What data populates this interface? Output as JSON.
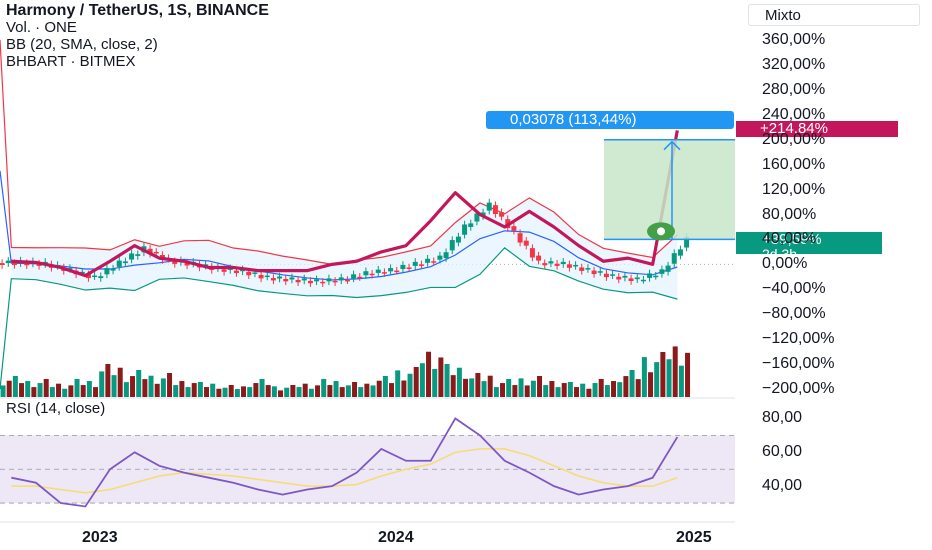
{
  "header": {
    "symbol_title": "Harmony / TetherUS, 1S, BINANCE",
    "volume_label": "Vol. · ONE",
    "bb_label": "BB (20, SMA, close, 2)",
    "compare_label": "BHBART · BITMEX",
    "rsi_label": "RSI (14, close)"
  },
  "toolbar": {
    "scale_mode": "Mixto"
  },
  "price_axis": {
    "labels": [
      "360,00%",
      "320,00%",
      "280,00%",
      "240,00%",
      "200,00%",
      "160,00%",
      "120,00%",
      "80,00%",
      "40,00%",
      "0,00%",
      "−40,00%",
      "−80,00%",
      "−120,00%",
      "−160,00%",
      "−200,00%"
    ],
    "top_value": 360,
    "bottom_value": -200
  },
  "rsi_axis": {
    "labels": [
      "80,00",
      "60,00",
      "40,00"
    ],
    "upper_band": 70,
    "lower_band": 30
  },
  "time_axis": {
    "labels": [
      "2023",
      "2024",
      "2025"
    ]
  },
  "tags": {
    "red_value": "+214,84%",
    "green_value": "+39,59%",
    "green_countdown": "2d 3h",
    "measure_text": "0,03078 (113,44%)"
  },
  "colors": {
    "up": "#089981",
    "down": "#f23645",
    "compare_line": "#c2185b",
    "bb_basis": "#2962ff",
    "bb_upper": "#f23645",
    "bb_lower": "#089981",
    "bb_fill": "#e3f2fd",
    "rsi_line": "#7e57c2",
    "rsi_ma": "#f7dc6f",
    "rsi_band": "#ede7f6",
    "measure": "#2196f3",
    "target_box": "#c8e6c9"
  },
  "chart_data": [
    {
      "type": "line",
      "title": "Harmony / TetherUS, 1S, BINANCE",
      "ylabel": "%",
      "ylim": [
        -200,
        370
      ],
      "x_ticks": [
        "2023",
        "2024",
        "2025"
      ],
      "series": [
        {
          "name": "Harmony / TetherUS",
          "x": [
            "2022-09",
            "2022-10",
            "2022-11",
            "2022-12",
            "2023-01",
            "2023-02",
            "2023-03",
            "2023-04",
            "2023-05",
            "2023-06",
            "2023-07",
            "2023-08",
            "2023-09",
            "2023-10",
            "2023-11",
            "2023-12",
            "2024-01",
            "2024-02",
            "2024-03",
            "2024-04",
            "2024-05",
            "2024-06",
            "2024-07",
            "2024-08",
            "2024-09",
            "2024-10",
            "2024-11",
            "2024-12"
          ],
          "values": [
            2,
            0,
            -10,
            -22,
            2,
            25,
            5,
            0,
            -8,
            -12,
            -22,
            -25,
            -28,
            -25,
            -15,
            -10,
            0,
            10,
            60,
            95,
            50,
            2,
            0,
            -10,
            -20,
            -25,
            -12,
            40
          ]
        },
        {
          "name": "BHBART · BITMEX",
          "x": [
            "2022-09",
            "2022-10",
            "2022-11",
            "2022-12",
            "2023-01",
            "2023-02",
            "2023-03",
            "2023-04",
            "2023-05",
            "2023-06",
            "2023-07",
            "2023-08",
            "2023-09",
            "2023-10",
            "2023-11",
            "2023-12",
            "2024-01",
            "2024-02",
            "2024-03",
            "2024-04",
            "2024-05",
            "2024-06",
            "2024-07",
            "2024-08",
            "2024-09",
            "2024-10",
            "2024-11",
            "2024-12"
          ],
          "values": [
            5,
            3,
            -5,
            -18,
            5,
            30,
            10,
            5,
            -5,
            -5,
            -10,
            -10,
            -10,
            0,
            5,
            20,
            30,
            70,
            115,
            80,
            60,
            85,
            60,
            30,
            5,
            10,
            0,
            215
          ]
        }
      ]
    },
    {
      "type": "bar",
      "title": "Vol. · ONE",
      "values_relative": [
        0.35,
        0.3,
        0.25,
        0.3,
        0.55,
        0.45,
        0.4,
        0.3,
        0.25,
        0.2,
        0.3,
        0.2,
        0.25,
        0.3,
        0.25,
        0.35,
        0.5,
        0.85,
        0.55,
        0.4,
        0.3,
        0.35,
        0.3,
        0.25,
        0.3,
        0.45,
        0.75,
        0.95
      ]
    },
    {
      "type": "line",
      "title": "RSI (14, close)",
      "ylim": [
        20,
        85
      ],
      "series": [
        {
          "name": "RSI",
          "values": [
            45,
            42,
            30,
            28,
            50,
            60,
            52,
            48,
            45,
            42,
            38,
            35,
            38,
            40,
            48,
            62,
            55,
            55,
            80,
            70,
            55,
            48,
            40,
            35,
            38,
            40,
            45,
            69
          ]
        },
        {
          "name": "RSI MA",
          "values": [
            40,
            40,
            38,
            36,
            38,
            42,
            46,
            48,
            47,
            46,
            44,
            42,
            40,
            40,
            41,
            46,
            50,
            53,
            60,
            62,
            62,
            58,
            52,
            46,
            42,
            40,
            40,
            45
          ]
        }
      ]
    }
  ]
}
